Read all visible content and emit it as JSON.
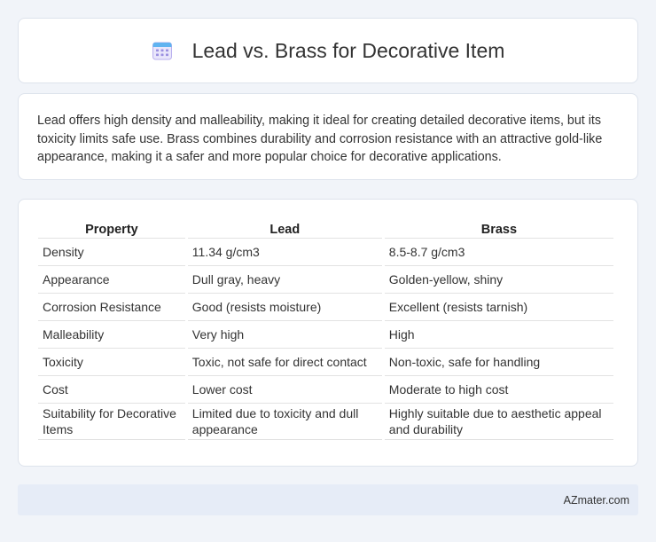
{
  "header": {
    "title": "Lead vs. Brass for Decorative Item",
    "icon": "calendar-icon"
  },
  "intro": {
    "text": "Lead offers high density and malleability, making it ideal for creating detailed decorative items, but its toxicity limits safe use. Brass combines durability and corrosion resistance with an attractive gold-like appearance, making it a safer and more popular choice for decorative applications."
  },
  "table": {
    "headers": [
      "Property",
      "Lead",
      "Brass"
    ],
    "rows": [
      [
        "Density",
        "11.34 g/cm3",
        "8.5-8.7 g/cm3"
      ],
      [
        "Appearance",
        "Dull gray, heavy",
        "Golden-yellow, shiny"
      ],
      [
        "Corrosion Resistance",
        "Good (resists moisture)",
        "Excellent (resists tarnish)"
      ],
      [
        "Malleability",
        "Very high",
        "High"
      ],
      [
        "Toxicity",
        "Toxic, not safe for direct contact",
        "Non-toxic, safe for handling"
      ],
      [
        "Cost",
        "Lower cost",
        "Moderate to high cost"
      ],
      [
        "Suitability for Decorative Items",
        "Limited due to toxicity and dull appearance",
        "Highly suitable due to aesthetic appeal and durability"
      ]
    ]
  },
  "footer": {
    "text": "AZmater.com"
  },
  "colors": {
    "background": "#f1f4f9",
    "card": "#ffffff",
    "footer": "#e6ecf7",
    "icon_accent": "#8a7fd6"
  }
}
